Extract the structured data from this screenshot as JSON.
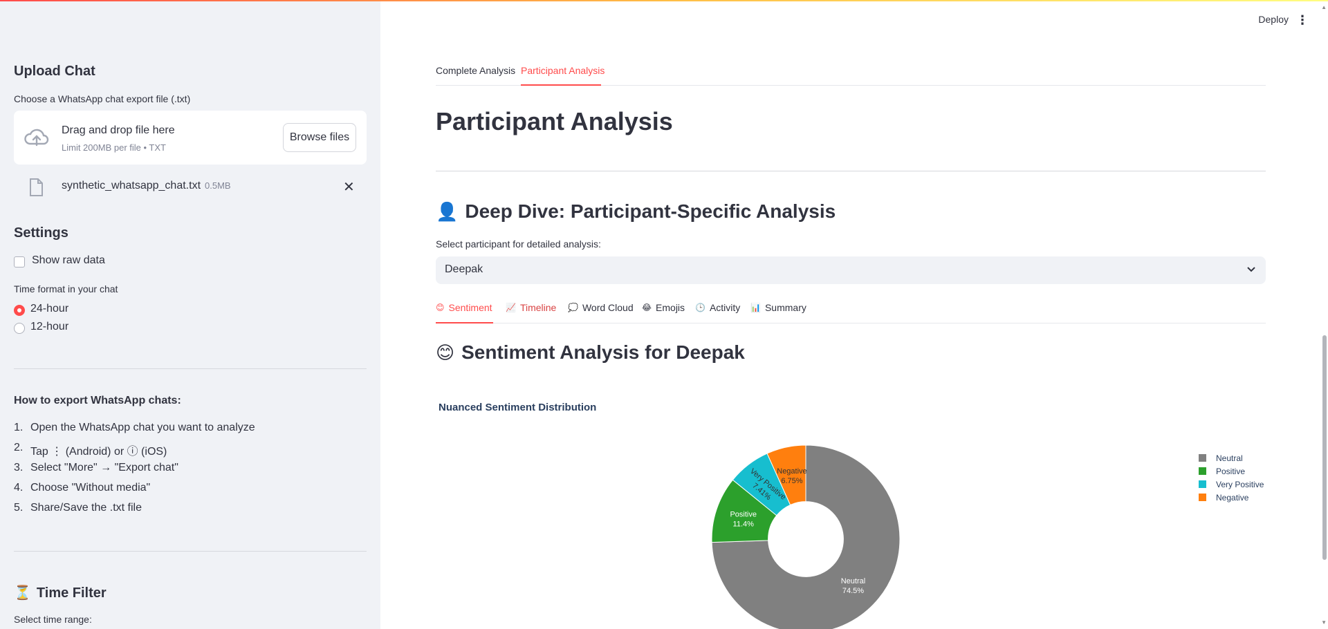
{
  "header": {
    "deploy_label": "Deploy",
    "menu_icon": "kebab-icon"
  },
  "sidebar": {
    "upload_title": "Upload Chat",
    "uploader_label": "Choose a WhatsApp chat export file (.txt)",
    "dropzone_title": "Drag and drop file here",
    "dropzone_limit": "Limit 200MB per file • TXT",
    "browse_label": "Browse files",
    "file_name": "synthetic_whatsapp_chat.txt",
    "file_size": "0.5MB",
    "settings_title": "Settings",
    "show_raw_label": "Show raw data",
    "show_raw_checked": false,
    "time_format_label": "Time format in your chat",
    "time_options": [
      "24-hour",
      "12-hour"
    ],
    "time_selected": "24-hour",
    "how_title": "How to export WhatsApp chats:",
    "steps": [
      "Open the WhatsApp chat you want to analyze",
      "Tap ⋮ (Android) or ⓘ (iOS)",
      "Select \"More\" → \"Export chat\"",
      "Choose \"Without media\"",
      "Share/Save the .txt file"
    ],
    "time_filter_icon": "⏳",
    "time_filter_title": "Time Filter",
    "time_range_label": "Select time range:"
  },
  "main": {
    "tabs": [
      "Complete Analysis",
      "Participant Analysis"
    ],
    "active_tab": "Participant Analysis",
    "page_title": "Participant Analysis",
    "deep_dive_icon": "👤",
    "deep_dive_title": "Deep Dive: Participant-Specific Analysis",
    "select_label": "Select participant for detailed analysis:",
    "selected_participant": "Deepak",
    "subtabs": [
      {
        "icon": "😊",
        "label": "Sentiment"
      },
      {
        "icon": "📈",
        "label": "Timeline"
      },
      {
        "icon": "💭",
        "label": "Word Cloud"
      },
      {
        "icon": "😂",
        "label": "Emojis"
      },
      {
        "icon": "🕒",
        "label": "Activity"
      },
      {
        "icon": "📊",
        "label": "Summary"
      }
    ],
    "active_subtab": "Sentiment",
    "sentiment_icon": "😊",
    "sentiment_title": "Sentiment Analysis for Deepak"
  },
  "chart_data": {
    "type": "pie",
    "title": "Nuanced Sentiment Distribution",
    "hole": 0.4,
    "legend_position": "right",
    "slices": [
      {
        "name": "Neutral",
        "value": 74.5,
        "label": "74.5%",
        "color": "#808080"
      },
      {
        "name": "Positive",
        "value": 11.4,
        "label": "11.4%",
        "color": "#2ca02c"
      },
      {
        "name": "Very Positive",
        "value": 7.41,
        "label": "7.41%",
        "color": "#17becf"
      },
      {
        "name": "Negative",
        "value": 6.75,
        "label": "6.75%",
        "color": "#ff7f0e"
      }
    ]
  }
}
